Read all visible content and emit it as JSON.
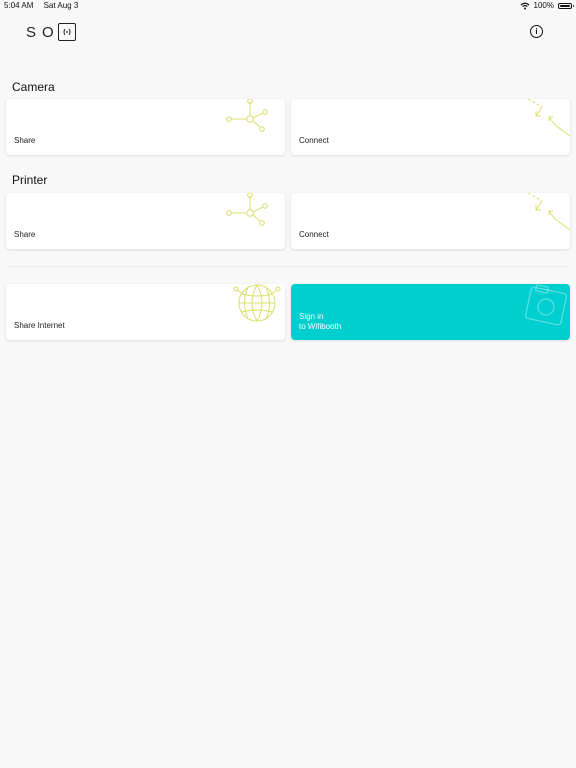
{
  "status_bar": {
    "time": "5:04 AM",
    "date": "Sat Aug 3",
    "battery_percent": "100%",
    "battery_level": 1.0
  },
  "header": {
    "logo_text": "SO",
    "logo_icon": "camera-box-icon",
    "info_icon": "info-icon"
  },
  "sections": {
    "camera": {
      "title": "Camera",
      "share_label": "Share",
      "connect_label": "Connect"
    },
    "printer": {
      "title": "Printer",
      "share_label": "Share",
      "connect_label": "Connect"
    }
  },
  "actions": {
    "share_internet_label": "Share Internet",
    "signin_line1": "Sign in",
    "signin_line2": "to Wifibooth"
  },
  "colors": {
    "accent": "#00cfd0",
    "decor": "#d8e06a",
    "background": "#f9f9f9"
  }
}
